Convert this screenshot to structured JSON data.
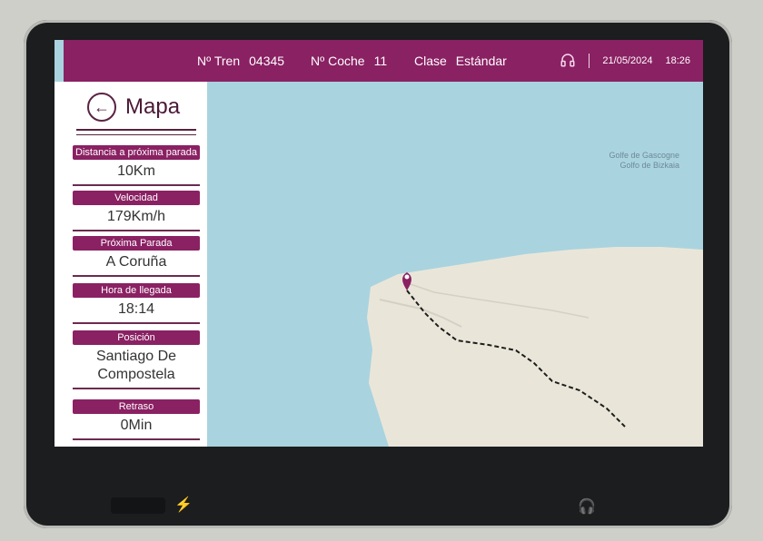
{
  "topbar": {
    "train_label": "Nº Tren",
    "train_value": "04345",
    "coach_label": "Nº Coche",
    "coach_value": "11",
    "class_label": "Clase",
    "class_value": "Estándar",
    "date": "21/05/2024",
    "time": "18:26"
  },
  "sidebar": {
    "title": "Mapa",
    "cards": [
      {
        "label": "Distancia a próxima parada",
        "value": "10Km"
      },
      {
        "label": "Velocidad",
        "value": "179Km/h"
      },
      {
        "label": "Próxima Parada",
        "value": "A Coruña"
      },
      {
        "label": "Hora de llegada",
        "value": "18:14"
      },
      {
        "label": "Posición",
        "value": "Santiago De Compostela"
      },
      {
        "label": "Retraso",
        "value": "0Min"
      }
    ]
  },
  "map": {
    "sea_label_1": "Golfe de Gascogne",
    "sea_label_2": "Golfo de Bizkaia",
    "colors": {
      "sea": "#a9d3df",
      "land": "#e9e6d9",
      "route": "#1d1d1d",
      "marker": "#8a2163"
    }
  },
  "icons": {
    "back": "arrow-left-icon",
    "headphones": "headphones-icon",
    "bolt": "lightning-bolt-icon",
    "pin": "map-pin-icon"
  },
  "colors": {
    "brand": "#8a2163",
    "bezel": "#1b1d1f"
  }
}
